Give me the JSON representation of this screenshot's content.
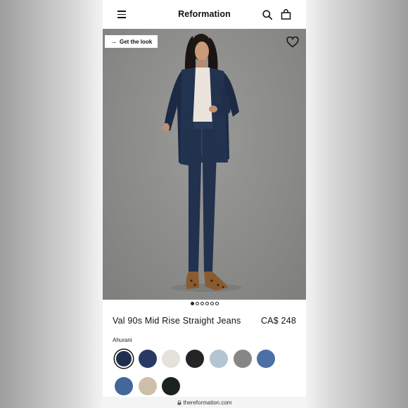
{
  "header": {
    "brand": "Reformation",
    "menu_icon": "hamburger-menu-icon",
    "search_icon": "search-icon",
    "bag_icon": "shopping-bag-icon"
  },
  "hero": {
    "get_look_label": "Get the look",
    "heart_icon": "heart-icon",
    "carousel_total": 6,
    "carousel_current": 1
  },
  "product": {
    "name": "Val 90s Mid Rise Straight Jeans",
    "price": "CA$ 248",
    "selected_color": "Ahurani"
  },
  "swatches": [
    {
      "color": "#1f2e4f",
      "selected": true
    },
    {
      "color": "#283a63",
      "selected": false
    },
    {
      "color": "#e4e2dc",
      "selected": false
    },
    {
      "color": "#242424",
      "selected": false
    },
    {
      "color": "#b3c4d3",
      "selected": false
    },
    {
      "color": "#868686",
      "selected": false
    },
    {
      "color": "#4c6fa6",
      "selected": false
    },
    {
      "color": "#43679c",
      "selected": false
    },
    {
      "color": "#cdbfa8",
      "selected": false
    },
    {
      "color": "#1b2320",
      "selected": false
    }
  ],
  "browser": {
    "url": "thereformation.com",
    "lock_icon": "lock-icon"
  }
}
